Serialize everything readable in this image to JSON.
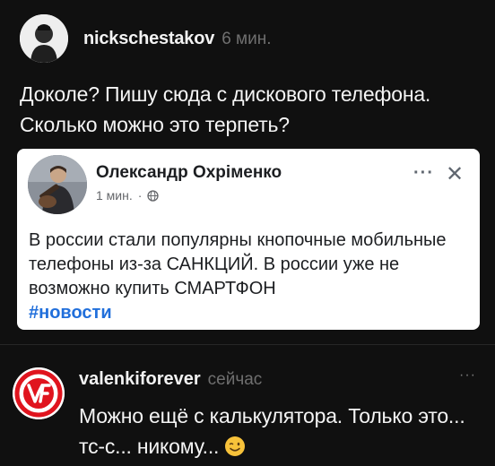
{
  "post": {
    "username": "nickschestakov",
    "time": "6 мин.",
    "text": "Доколе? Пишу сюда с дискового телефона. Сколько можно это терпеть?",
    "avatar_icon": "person-avatar"
  },
  "embed": {
    "author": "Олександр Охріменко",
    "time": "1 мин.",
    "separator": "·",
    "privacy_icon": "globe-icon",
    "more_label": "···",
    "close_label": "✕",
    "body": "В россии стали популярны кнопочные мобильные телефоны из-за САНКЦИЙ. В россии уже не возможно купить СМАРТФОН",
    "hashtag": "#новости"
  },
  "comment": {
    "username": "valenkiforever",
    "time": "сейчас",
    "more_label": "···",
    "text": "Можно ещё с калькулятора. Только это... тс-с... никому...",
    "emoji_icon": "wink-emoji",
    "logo_letters": "VF"
  },
  "colors": {
    "background": "#101010",
    "text": "#f4f4f4",
    "muted": "#6f6f6f",
    "hashtag": "#216fdb",
    "logo_red": "#e0141e"
  }
}
